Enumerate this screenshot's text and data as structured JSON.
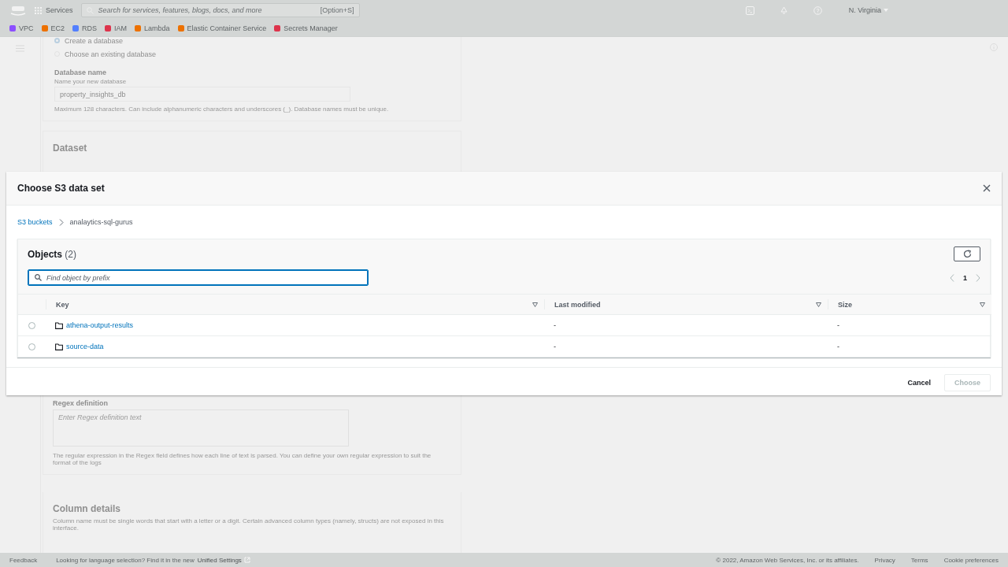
{
  "top_nav": {
    "services_label": "Services",
    "search": {
      "placeholder": "Search for services, features, blogs, docs, and more",
      "shortcut": "[Option+S]"
    },
    "region": "N. Virginia"
  },
  "favorites": [
    {
      "label": "VPC",
      "color": "#8c4fff"
    },
    {
      "label": "EC2",
      "color": "#ed7100"
    },
    {
      "label": "RDS",
      "color": "#527fff"
    },
    {
      "label": "IAM",
      "color": "#dd344c"
    },
    {
      "label": "Lambda",
      "color": "#ed7100"
    },
    {
      "label": "Elastic Container Service",
      "color": "#ed7100"
    },
    {
      "label": "Secrets Manager",
      "color": "#dd344c"
    }
  ],
  "page": {
    "database_options": [
      {
        "label": "Create a database",
        "selected": true
      },
      {
        "label": "Choose an existing database",
        "selected": false
      }
    ],
    "database_name": {
      "label": "Database name",
      "description": "Name your new database",
      "value": "property_insights_db",
      "constraint": "Maximum 128 characters. Can include alphanumeric characters and underscores (_). Database names must be unique."
    },
    "dataset_heading": "Dataset",
    "regex": {
      "label": "Regex definition",
      "placeholder": "Enter Regex definition text",
      "description": "The regular expression in the Regex field defines how each line of text is parsed. You can define your own regular expression to suit the format of the logs"
    },
    "column_details": {
      "heading": "Column details",
      "description": "Column name must be single words that start with a letter or a digit. Certain advanced column types (namely, structs) are not exposed in this interface."
    }
  },
  "modal": {
    "title": "Choose S3 data set",
    "breadcrumbs": [
      {
        "label": "S3 buckets",
        "kind": "link"
      },
      {
        "label": "analaytics-sql-gurus",
        "kind": "current"
      }
    ],
    "objects": {
      "heading": "Objects",
      "count": "(2)",
      "search_placeholder": "Find object by prefix",
      "page": "1",
      "columns": [
        "Key",
        "Last modified",
        "Size"
      ],
      "rows": [
        {
          "key": "athena-output-results",
          "last_modified": "-",
          "size": "-",
          "selected": false
        },
        {
          "key": "source-data",
          "last_modified": "-",
          "size": "-",
          "selected": false
        }
      ]
    },
    "buttons": [
      {
        "label": "Cancel",
        "kind": "link",
        "disabled": false
      },
      {
        "label": "Choose",
        "kind": "primary",
        "disabled": true
      }
    ]
  },
  "footer": {
    "feedback": "Feedback",
    "notice": "Looking for language selection? Find it in the new",
    "notice_link": "Unified Settings",
    "copyright": "© 2022, Amazon Web Services, Inc. or its affiliates.",
    "links": [
      "Privacy",
      "Terms",
      "Cookie preferences"
    ]
  }
}
